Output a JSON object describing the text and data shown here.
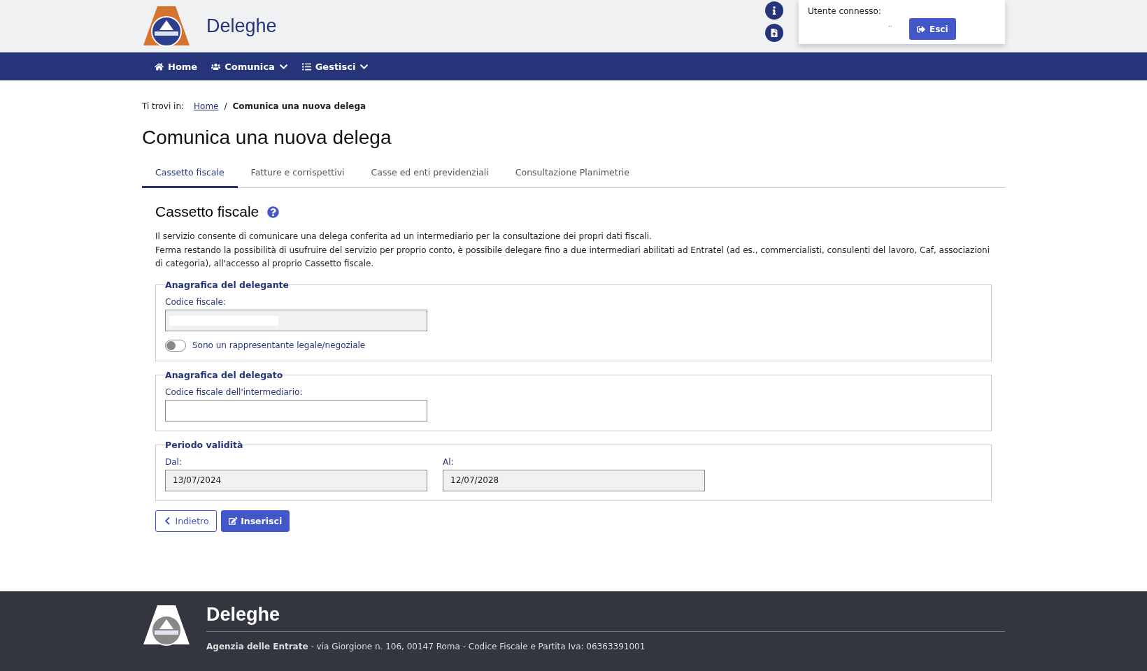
{
  "header": {
    "title": "Deleghe",
    "user_label": "Utente connesso:",
    "user_name": "..",
    "logout": "Esci"
  },
  "nav": [
    {
      "label": "Home",
      "dropdown": false
    },
    {
      "label": "Comunica",
      "dropdown": true
    },
    {
      "label": "Gestisci",
      "dropdown": true
    }
  ],
  "breadcrumb": {
    "prefix": "Ti trovi in:",
    "separator": "/",
    "items": [
      {
        "label": "Home",
        "link": true
      },
      {
        "label": "Comunica una nuova delega",
        "link": false
      }
    ]
  },
  "page_title": "Comunica una nuova delega",
  "tabs": [
    {
      "label": "Cassetto fiscale",
      "selected": true
    },
    {
      "label": "Fatture e corrispettivi",
      "selected": false
    },
    {
      "label": "Casse ed enti previdenziali",
      "selected": false
    },
    {
      "label": "Consultazione Planimetrie",
      "selected": false
    }
  ],
  "section": {
    "title": "Cassetto fiscale",
    "paragraphs": [
      "Il servizio consente di comunicare una delega conferita ad un intermediario per la consultazione dei propri dati fiscali.",
      "Ferma restando la possibilità di usufruire del servizio per proprio conto, è possibile delegare fino a due intermediari abilitati ad Entratel (ad es., commercialisti, consulenti del lavoro, Caf, associazioni di categoria), all'accesso al proprio Cassetto fiscale."
    ]
  },
  "fieldsets": [
    {
      "legend": "Anagrafica del delegante",
      "fields": [
        {
          "label": "Codice fiscale:",
          "disabled": true,
          "redacted": true
        }
      ],
      "toggle": {
        "label": "Sono un rappresentante legale/negoziale",
        "on": false
      }
    },
    {
      "legend": "Anagrafica del delegato",
      "fields": [
        {
          "label": "Codice fiscale dell'intermediario:",
          "disabled": false
        }
      ]
    },
    {
      "legend": "Periodo validità",
      "fields": [
        {
          "label": "Dal:",
          "value": "13/07/2024",
          "disabled": true
        },
        {
          "label": "Al:",
          "value": "12/07/2028",
          "disabled": true
        }
      ]
    }
  ],
  "buttons": [
    {
      "label": "Indietro",
      "kind": "secondary"
    },
    {
      "label": "Inserisci",
      "kind": "primary"
    }
  ],
  "footer": {
    "title": "Deleghe",
    "org": "Agenzia delle Entrate",
    "address": " - via Giorgione n. 106, 00147 Roma - Codice Fiscale e Partita Iva: 06363391001"
  }
}
